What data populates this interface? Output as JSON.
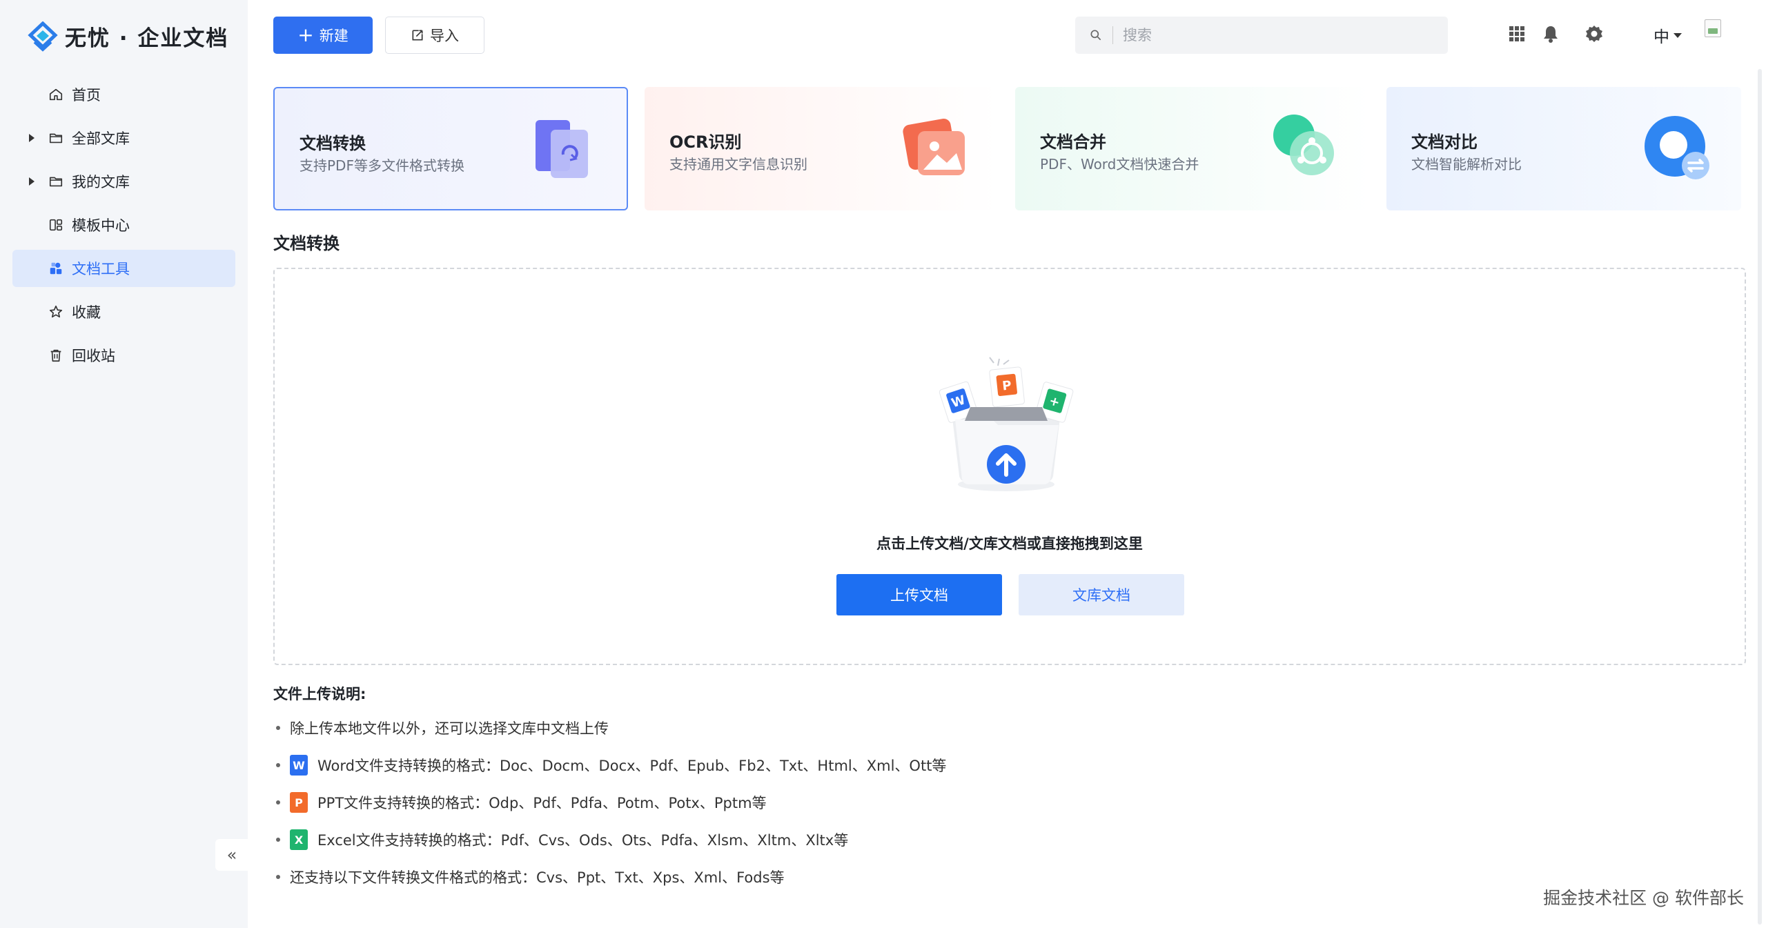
{
  "app": {
    "brand": "无忧 · 企业文档"
  },
  "sidebar": {
    "items": [
      {
        "label": "首页",
        "icon": "home-icon",
        "expandable": false,
        "active": false
      },
      {
        "label": "全部文库",
        "icon": "folder-icon",
        "expandable": true,
        "active": false
      },
      {
        "label": "我的文库",
        "icon": "folder-icon",
        "expandable": true,
        "active": false
      },
      {
        "label": "模板中心",
        "icon": "template-icon",
        "expandable": false,
        "active": false
      },
      {
        "label": "文档工具",
        "icon": "tools-icon",
        "expandable": false,
        "active": true
      },
      {
        "label": "收藏",
        "icon": "star-icon",
        "expandable": false,
        "active": false
      },
      {
        "label": "回收站",
        "icon": "trash-icon",
        "expandable": false,
        "active": false
      }
    ],
    "collapse_label": "«"
  },
  "toolbar": {
    "new_label": "新建",
    "import_label": "导入",
    "search_placeholder": "搜索",
    "lang_label": "中"
  },
  "tools": [
    {
      "title": "文档转换",
      "desc": "支持PDF等多文件格式转换",
      "icon": "doc-convert-icon",
      "selected": true
    },
    {
      "title": "OCR识别",
      "desc": "支持通用文字信息识别",
      "icon": "ocr-icon",
      "selected": false
    },
    {
      "title": "文档合并",
      "desc": "PDF、Word文档快速合并",
      "icon": "doc-merge-icon",
      "selected": false
    },
    {
      "title": "文档对比",
      "desc": "文档智能解析对比",
      "icon": "doc-compare-icon",
      "selected": false
    }
  ],
  "section": {
    "title": "文档转换",
    "upload_hint": "点击上传文档/文库文档或直接拖拽到这里",
    "upload_button": "上传文档",
    "library_button": "文库文档"
  },
  "notes": {
    "title": "文件上传说明:",
    "items": [
      {
        "text": "除上传本地文件以外，还可以选择文库中文档上传",
        "file_icon": null,
        "icon_glyph": ""
      },
      {
        "text": "Word文件支持转换的格式：Doc、Docm、Docx、Pdf、Epub、Fb2、Txt、Html、Xml、Ott等",
        "file_icon": "word",
        "icon_glyph": "W"
      },
      {
        "text": "PPT文件支持转换的格式：Odp、Pdf、Pdfa、Potm、Potx、Pptm等",
        "file_icon": "ppt",
        "icon_glyph": "P"
      },
      {
        "text": "Excel文件支持转换的格式：Pdf、Cvs、Ods、Ots、Pdfa、Xlsm、Xltm、Xltx等",
        "file_icon": "excel",
        "icon_glyph": "X"
      },
      {
        "text": "还支持以下文件转换文件格式的格式：Cvs、Ppt、Txt、Xps、Xml、Fods等",
        "file_icon": null,
        "icon_glyph": ""
      }
    ]
  },
  "watermark": "掘金技术社区 @ 软件部长",
  "colors": {
    "primary": "#2f6ff0",
    "sidebar_bg": "#f4f6f9",
    "active_bg": "#dfe9fc"
  }
}
